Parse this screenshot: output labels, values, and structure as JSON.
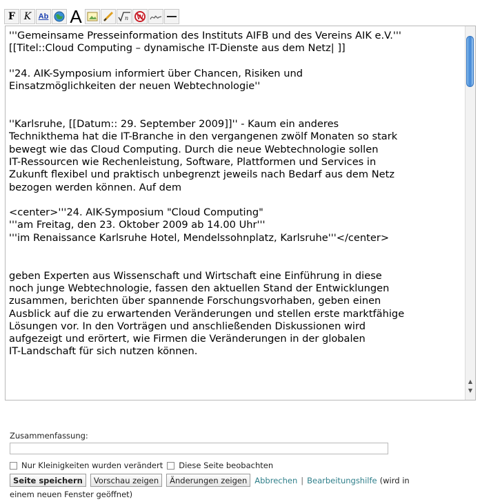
{
  "toolbar": {
    "bold": "F",
    "italic": "K",
    "link": "Ab",
    "headline": "A"
  },
  "editor": {
    "lines": [
      "'''Gemeinsame Presseinformation des Instituts AIFB und des Vereins AIK e.V.'''",
      "[[Titel::Cloud Computing – dynamische IT-Dienste aus dem Netz| ]]",
      "",
      "''24. AIK-Symposium informiert über Chancen, Risiken und",
      "Einsatzmöglichkeiten der neuen Webtechnologie''",
      "",
      "",
      "''Karlsruhe, [[Datum:: 29. September 2009]]'' - Kaum ein anderes",
      "Technikthema hat die IT-Branche in den vergangenen zwölf Monaten so stark",
      "bewegt wie das Cloud Computing. Durch die neue Webtechnologie sollen",
      "IT-Ressourcen wie Rechenleistung, Software, Plattformen und Services in",
      "Zukunft flexibel und praktisch unbegrenzt jeweils nach Bedarf aus dem Netz",
      "bezogen werden können. Auf dem",
      "",
      "<center>'''24. AIK-Symposium \"Cloud Computing\"",
      "'''am Freitag, den 23. Oktober 2009 ab 14.00 Uhr'''",
      "'''im Renaissance Karlsruhe Hotel, Mendelssohnplatz, Karlsruhe'''</center>",
      "",
      "",
      "geben Experten aus Wissenschaft und Wirtschaft eine Einführung in diese",
      "noch junge Webtechnologie, fassen den aktuellen Stand der Entwicklungen",
      "zusammen, berichten über spannende Forschungsvorhaben, geben einen",
      "Ausblick auf die zu erwartenden Veränderungen und stellen erste marktfähige",
      "Lösungen vor. In den Vorträgen und anschließenden Diskussionen wird",
      "aufgezeigt und erörtert, wie Firmen die Veränderungen in der globalen",
      "IT-Landschaft für sich nutzen können."
    ]
  },
  "form": {
    "summary_label": "Zusammenfassung:",
    "summary_value": "",
    "minor_edit_label": "Nur Kleinigkeiten wurden verändert",
    "watch_label": "Diese Seite beobachten",
    "save_label": "Seite speichern",
    "preview_label": "Vorschau zeigen",
    "diff_label": "Änderungen zeigen",
    "cancel_label": "Abbrechen",
    "separator": "|",
    "help_label": "Bearbeitungshilfe",
    "help_note_1": "(wird in",
    "help_note_2": "einem neuen Fenster geöffnet)"
  },
  "colors": {
    "link": "#2f7f8a",
    "scroll_thumb": "#3f86d6"
  },
  "icons": [
    "bold-icon",
    "italic-icon",
    "link-icon",
    "external-link-icon",
    "headline-icon",
    "image-icon",
    "media-icon",
    "math-icon",
    "nowiki-icon",
    "signature-icon",
    "horizontal-rule-icon"
  ]
}
